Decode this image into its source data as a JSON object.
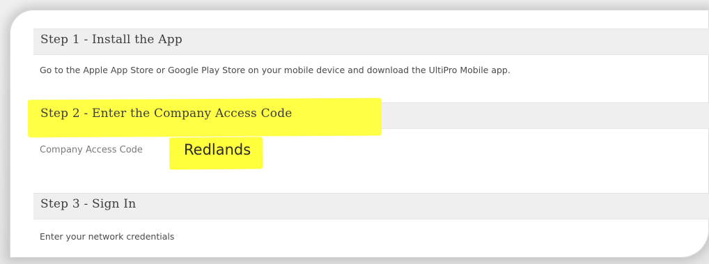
{
  "steps": [
    {
      "title": "Step 1 - Install the App",
      "body": "Go to the Apple App Store or Google Play Store on your mobile device and download the UltiPro Mobile app."
    },
    {
      "title": "Step 2 - Enter the Company Access Code",
      "field_label": "Company Access Code",
      "field_value": "Redlands"
    },
    {
      "title": "Step 3 - Sign In",
      "body": "Enter your network credentials"
    }
  ],
  "colors": {
    "highlight": "#ffff3b",
    "header_bg": "#efefef",
    "text": "#4a4a4a"
  }
}
